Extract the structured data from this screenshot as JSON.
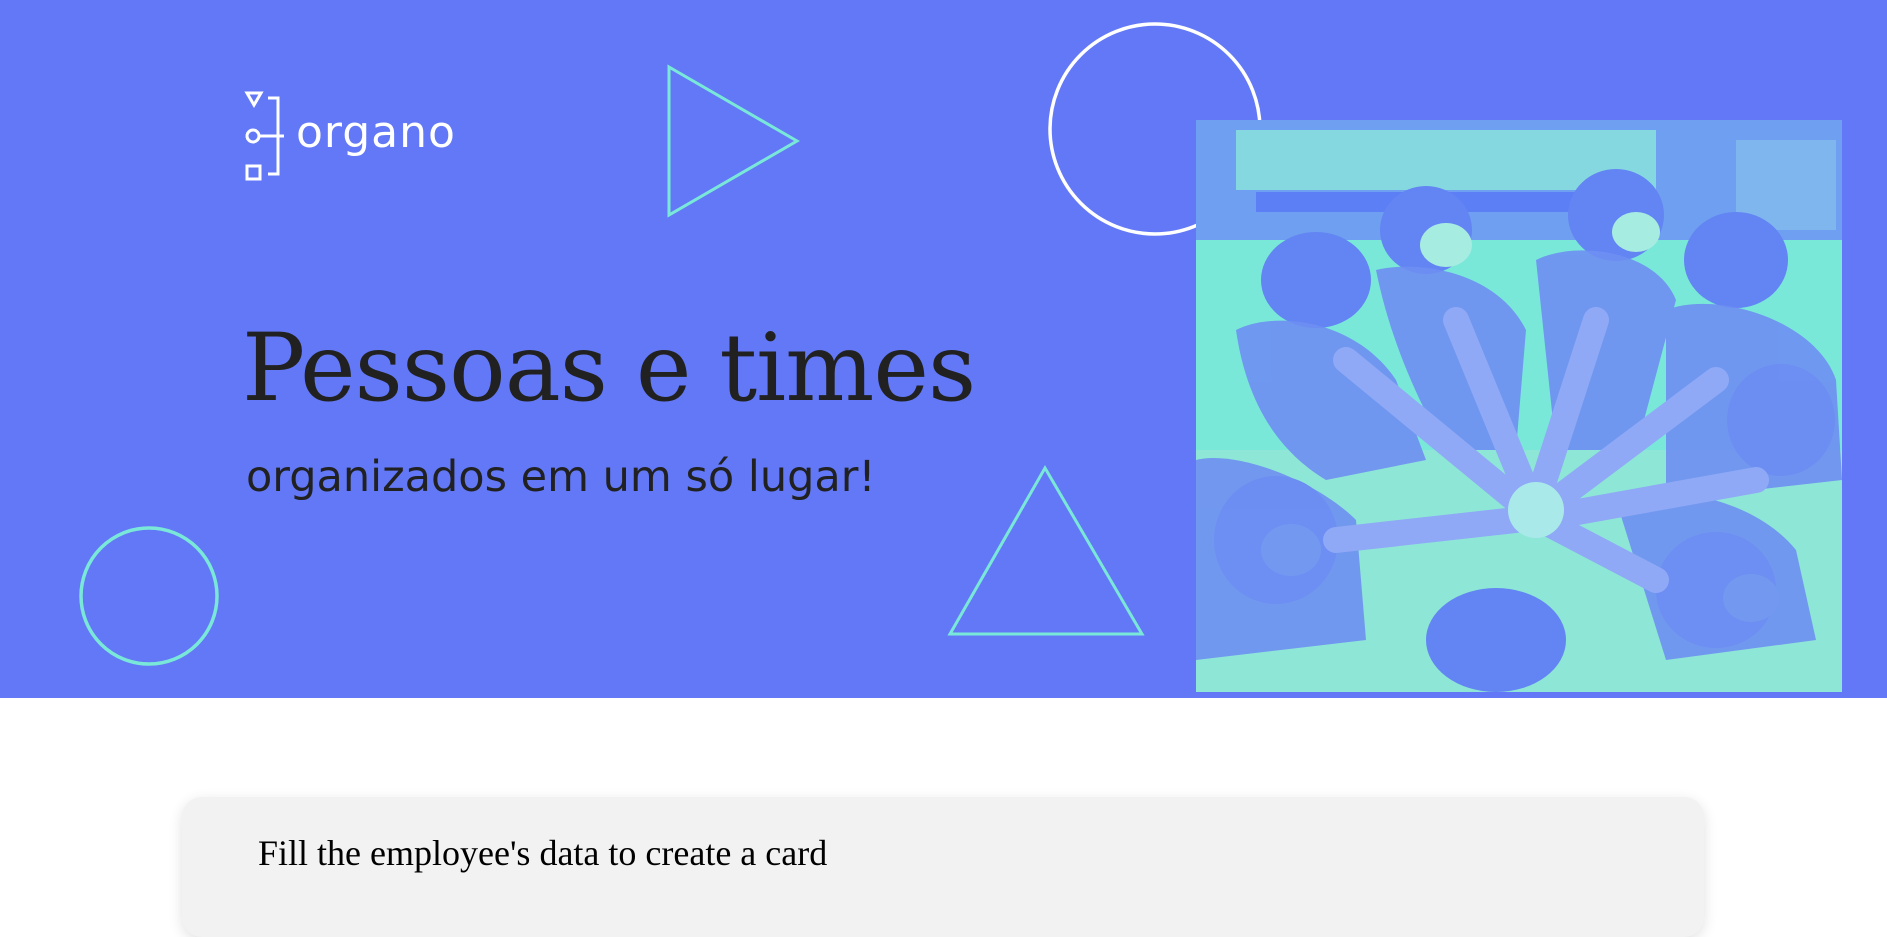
{
  "banner": {
    "logo": {
      "text": "organo"
    },
    "headline": "Pessoas e times",
    "subheadline": "organizados em um só lugar!",
    "hero_image": {
      "alt": "Pessoas em círculo juntando as mãos"
    }
  },
  "form": {
    "title": "Fill the employee's data to create a card"
  },
  "colors": {
    "banner_bg": "#6278f7",
    "accent": "#7ae8d9",
    "headline_text": "#212121",
    "form_bg": "#f2f2f2"
  },
  "icons": {
    "logo": "organo-logo-icon",
    "decor": [
      "circle-outline-icon",
      "triangle-outline-icon"
    ]
  }
}
